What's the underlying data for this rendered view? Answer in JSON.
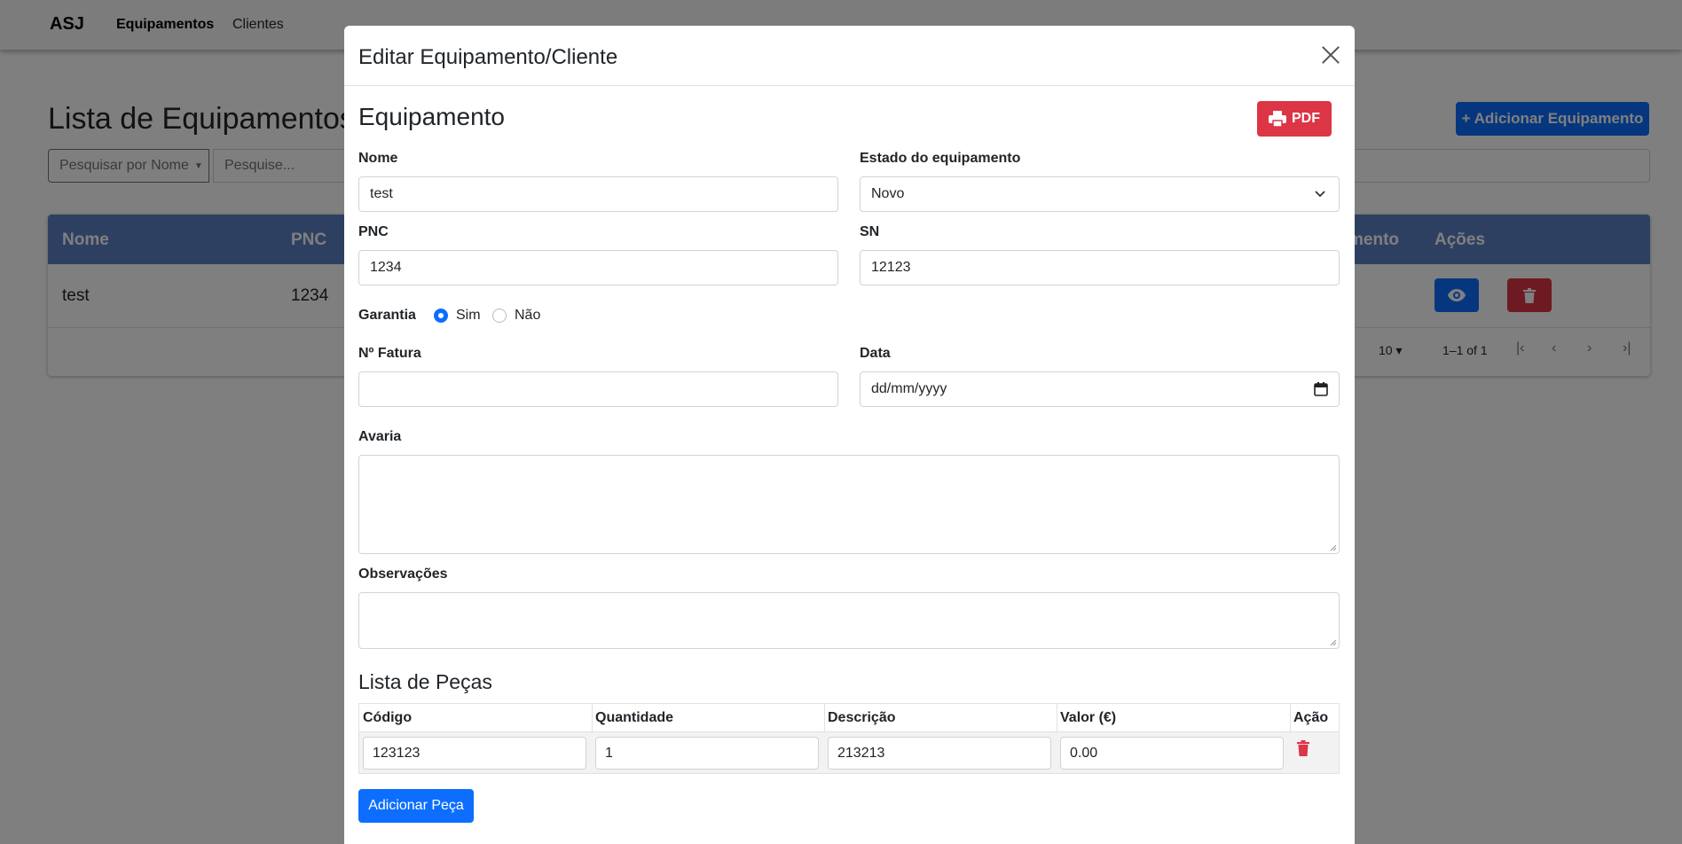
{
  "navbar": {
    "brand": "ASJ",
    "links": [
      {
        "label": "Equipamentos",
        "active": true
      },
      {
        "label": "Clientes",
        "active": false
      }
    ]
  },
  "page": {
    "title": "Lista de Equipamentos",
    "add_button": "+ Adicionar Equipamento",
    "search_dropdown": "Pesquisar por Nome",
    "search_placeholder": "Pesquise..."
  },
  "table": {
    "headers": {
      "nome": "Nome",
      "pnc": "PNC",
      "estado_partial": "mento",
      "acoes": "Ações"
    },
    "rows": [
      {
        "nome": "test",
        "pnc": "1234"
      }
    ],
    "pagination": {
      "rows_per_page": "10",
      "info": "1–1 of 1"
    }
  },
  "modal": {
    "title": "Editar Equipamento/Cliente",
    "section_title": "Equipamento",
    "pdf_label": "PDF",
    "fields": {
      "nome": {
        "label": "Nome",
        "value": "test"
      },
      "estado": {
        "label": "Estado do equipamento",
        "value": "Novo"
      },
      "pnc": {
        "label": "PNC",
        "value": "1234"
      },
      "sn": {
        "label": "SN",
        "value": "12123"
      },
      "garantia": {
        "label": "Garantia",
        "options": [
          "Sim",
          "Não"
        ],
        "selected": "Sim"
      },
      "fatura": {
        "label": "Nº Fatura",
        "value": ""
      },
      "data": {
        "label": "Data",
        "placeholder": "dd/mm/yyyy"
      },
      "avaria": {
        "label": "Avaria",
        "value": ""
      },
      "observacoes": {
        "label": "Observações",
        "value": ""
      }
    },
    "parts": {
      "title": "Lista de Peças",
      "headers": [
        "Código",
        "Quantidade",
        "Descrição",
        "Valor (€)",
        "Ação"
      ],
      "rows": [
        {
          "codigo": "123123",
          "quantidade": "1",
          "descricao": "213213",
          "valor": "0.00"
        }
      ],
      "add_button": "Adicionar Peça"
    }
  },
  "colors": {
    "primary": "#0d6efd",
    "danger": "#dc3545",
    "table_header": "#5d80c4"
  }
}
